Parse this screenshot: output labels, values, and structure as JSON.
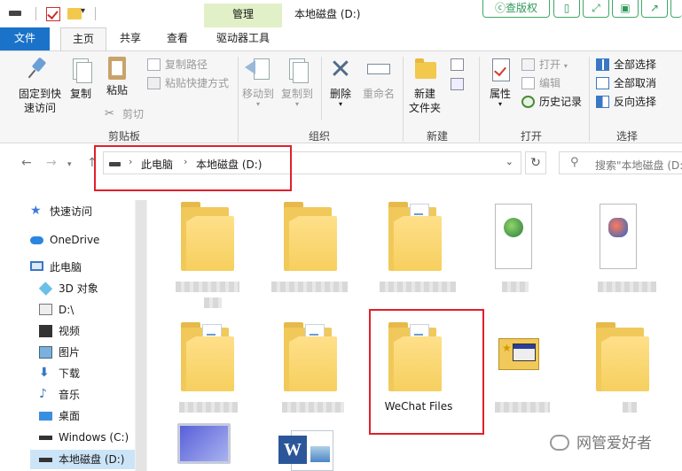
{
  "titlebar": {
    "manage_tab": "管理",
    "window_title": "本地磁盘 (D:)",
    "quick_access_dropdown": "▾"
  },
  "watermark_toolbar": {
    "check_label": "查版权"
  },
  "tabs": [
    {
      "label": "文件"
    },
    {
      "label": "主页"
    },
    {
      "label": "共享"
    },
    {
      "label": "查看"
    },
    {
      "label": "驱动器工具"
    }
  ],
  "ribbon": {
    "clipboard": {
      "pin_label": "固定到快\n速访问",
      "copy_label": "复制",
      "paste_label": "粘贴",
      "copy_path_label": "复制路径",
      "paste_shortcut_label": "粘贴快捷方式",
      "cut_label": "剪切",
      "group_label": "剪贴板"
    },
    "organize": {
      "move_to_label": "移动到",
      "copy_to_label": "复制到",
      "delete_label": "删除",
      "rename_label": "重命名",
      "group_label": "组织"
    },
    "new": {
      "new_folder_label": "新建\n文件夹",
      "group_label": "新建"
    },
    "open": {
      "properties_label": "属性",
      "open_label": "打开",
      "edit_label": "编辑",
      "history_label": "历史记录",
      "group_label": "打开"
    },
    "select": {
      "select_all_label": "全部选择",
      "select_none_label": "全部取消",
      "invert_label": "反向选择",
      "group_label": "选择"
    }
  },
  "address": {
    "crumbs": [
      "此电脑",
      "本地磁盘 (D:)"
    ],
    "search_placeholder": "搜索\"本地磁盘 (D:)\""
  },
  "navpane": {
    "items": [
      {
        "label": "快速访问"
      },
      {
        "label": "OneDrive"
      },
      {
        "label": "此电脑"
      },
      {
        "label": "3D 对象"
      },
      {
        "label": "D:\\"
      },
      {
        "label": "视频"
      },
      {
        "label": "图片"
      },
      {
        "label": "下载"
      },
      {
        "label": "音乐"
      },
      {
        "label": "桌面"
      },
      {
        "label": "Windows (C:)"
      },
      {
        "label": "本地磁盘 (D:)"
      }
    ]
  },
  "content": {
    "wechat_label": "WeChat Files"
  },
  "watermark": {
    "text": "网管爱好者"
  },
  "colors": {
    "file_tab": "#1a73c9",
    "manage_tab": "#e2f0c8",
    "highlight_box": "#e0202a",
    "selected_nav": "#cce4f7",
    "folder": "#f1c95a"
  }
}
